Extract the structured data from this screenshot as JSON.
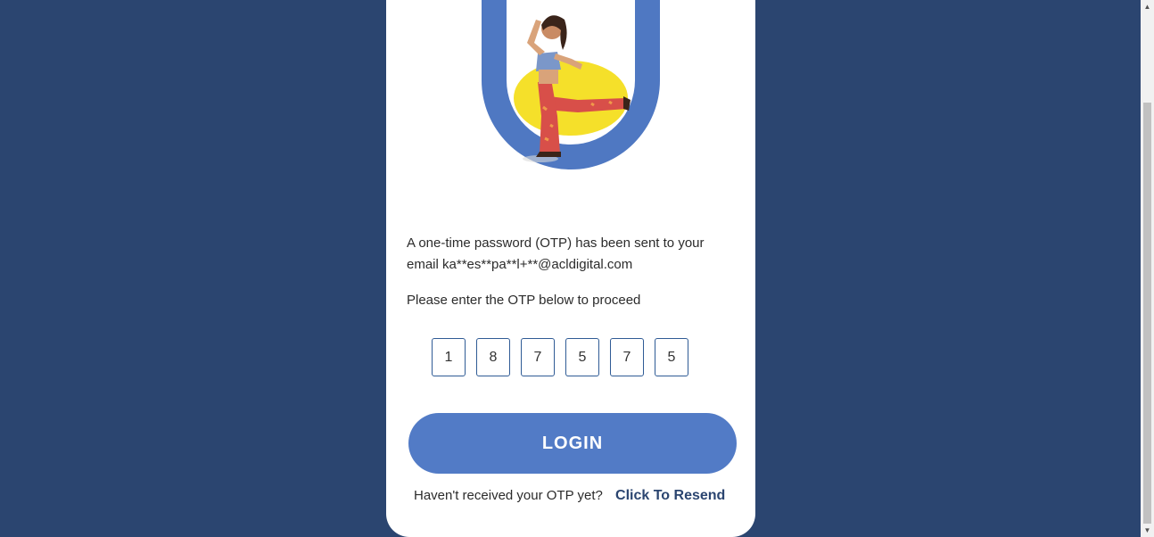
{
  "otp_message": {
    "sent_text": "A one-time password (OTP) has been sent to your email ka**es**pa**l+**@acldigital.com",
    "instruction": "Please enter the OTP below to proceed"
  },
  "otp_digits": [
    "1",
    "8",
    "7",
    "5",
    "7",
    "5"
  ],
  "login_button": {
    "label": "LOGIN"
  },
  "resend": {
    "prompt": "Haven't received your OTP yet?",
    "link_label": "Click To Resend"
  },
  "scrollbar": {
    "up_icon": "scroll-up-arrow-icon",
    "down_icon": "scroll-down-arrow-icon"
  },
  "colors": {
    "page_background": "#2b4570",
    "button": "#527bc6",
    "arch": "#4f78c2",
    "sun": "#f5e02a",
    "link": "#2b4570"
  }
}
